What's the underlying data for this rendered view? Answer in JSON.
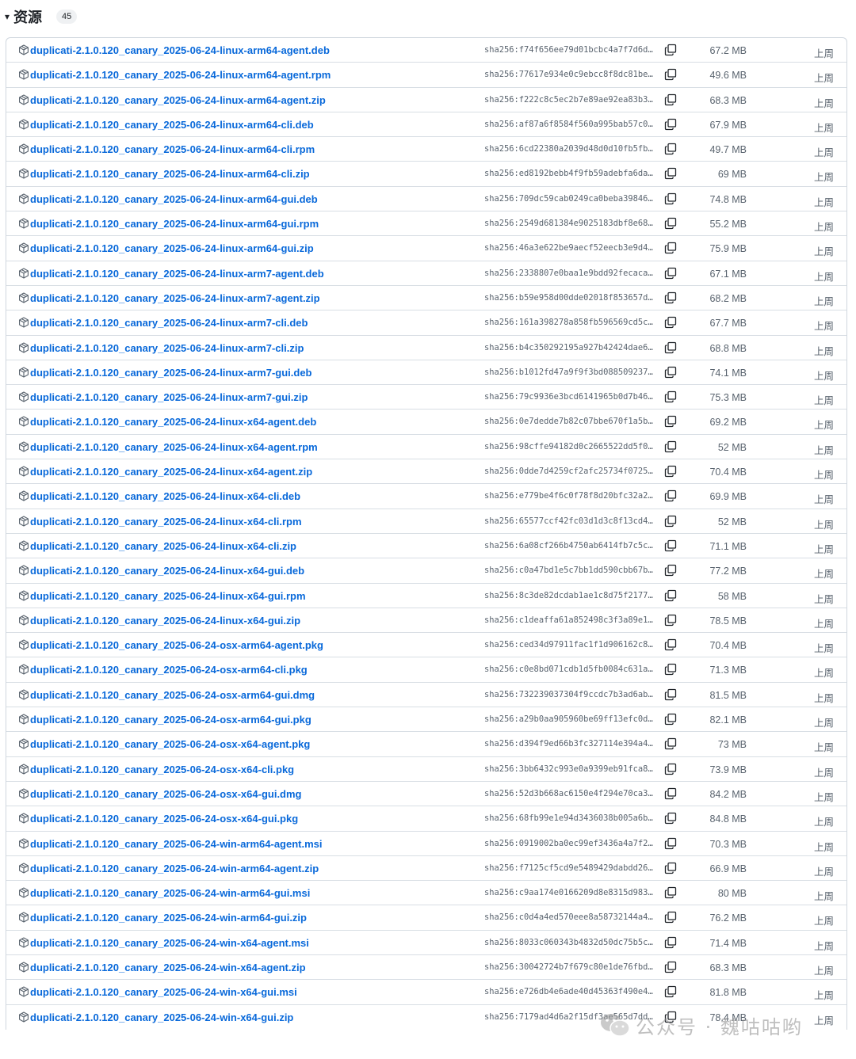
{
  "header": {
    "caret": "▾",
    "title": "资源",
    "count": "45"
  },
  "assets": [
    {
      "name": "duplicati-2.1.0.120_canary_2025-06-24-linux-arm64-agent.deb",
      "sha": "sha256:f74f656ee79d01bcbc4a7f7d6d…",
      "size": "67.2 MB",
      "time": "上周"
    },
    {
      "name": "duplicati-2.1.0.120_canary_2025-06-24-linux-arm64-agent.rpm",
      "sha": "sha256:77617e934e0c9ebcc8f8dc81be…",
      "size": "49.6 MB",
      "time": "上周"
    },
    {
      "name": "duplicati-2.1.0.120_canary_2025-06-24-linux-arm64-agent.zip",
      "sha": "sha256:f222c8c5ec2b7e89ae92ea83b3…",
      "size": "68.3 MB",
      "time": "上周"
    },
    {
      "name": "duplicati-2.1.0.120_canary_2025-06-24-linux-arm64-cli.deb",
      "sha": "sha256:af87a6f8584f560a995bab57c0…",
      "size": "67.9 MB",
      "time": "上周"
    },
    {
      "name": "duplicati-2.1.0.120_canary_2025-06-24-linux-arm64-cli.rpm",
      "sha": "sha256:6cd22380a2039d48d0d10fb5fb…",
      "size": "49.7 MB",
      "time": "上周"
    },
    {
      "name": "duplicati-2.1.0.120_canary_2025-06-24-linux-arm64-cli.zip",
      "sha": "sha256:ed8192bebb4f9fb59adebfa6da…",
      "size": "69 MB",
      "time": "上周"
    },
    {
      "name": "duplicati-2.1.0.120_canary_2025-06-24-linux-arm64-gui.deb",
      "sha": "sha256:709dc59cab0249ca0beba39846…",
      "size": "74.8 MB",
      "time": "上周"
    },
    {
      "name": "duplicati-2.1.0.120_canary_2025-06-24-linux-arm64-gui.rpm",
      "sha": "sha256:2549d681384e9025183dbf8e68…",
      "size": "55.2 MB",
      "time": "上周"
    },
    {
      "name": "duplicati-2.1.0.120_canary_2025-06-24-linux-arm64-gui.zip",
      "sha": "sha256:46a3e622be9aecf52eecb3e9d4…",
      "size": "75.9 MB",
      "time": "上周"
    },
    {
      "name": "duplicati-2.1.0.120_canary_2025-06-24-linux-arm7-agent.deb",
      "sha": "sha256:2338807e0baa1e9bdd92fecaca…",
      "size": "67.1 MB",
      "time": "上周"
    },
    {
      "name": "duplicati-2.1.0.120_canary_2025-06-24-linux-arm7-agent.zip",
      "sha": "sha256:b59e958d00dde02018f853657d…",
      "size": "68.2 MB",
      "time": "上周"
    },
    {
      "name": "duplicati-2.1.0.120_canary_2025-06-24-linux-arm7-cli.deb",
      "sha": "sha256:161a398278a858fb596569cd5c…",
      "size": "67.7 MB",
      "time": "上周"
    },
    {
      "name": "duplicati-2.1.0.120_canary_2025-06-24-linux-arm7-cli.zip",
      "sha": "sha256:b4c350292195a927b42424dae6…",
      "size": "68.8 MB",
      "time": "上周"
    },
    {
      "name": "duplicati-2.1.0.120_canary_2025-06-24-linux-arm7-gui.deb",
      "sha": "sha256:b1012fd47a9f9f3bd088509237…",
      "size": "74.1 MB",
      "time": "上周"
    },
    {
      "name": "duplicati-2.1.0.120_canary_2025-06-24-linux-arm7-gui.zip",
      "sha": "sha256:79c9936e3bcd6141965b0d7b46…",
      "size": "75.3 MB",
      "time": "上周"
    },
    {
      "name": "duplicati-2.1.0.120_canary_2025-06-24-linux-x64-agent.deb",
      "sha": "sha256:0e7dedde7b82c07bbe670f1a5b…",
      "size": "69.2 MB",
      "time": "上周"
    },
    {
      "name": "duplicati-2.1.0.120_canary_2025-06-24-linux-x64-agent.rpm",
      "sha": "sha256:98cffe94182d0c2665522dd5f0…",
      "size": "52 MB",
      "time": "上周"
    },
    {
      "name": "duplicati-2.1.0.120_canary_2025-06-24-linux-x64-agent.zip",
      "sha": "sha256:0dde7d4259cf2afc25734f0725…",
      "size": "70.4 MB",
      "time": "上周"
    },
    {
      "name": "duplicati-2.1.0.120_canary_2025-06-24-linux-x64-cli.deb",
      "sha": "sha256:e779be4f6c0f78f8d20bfc32a2…",
      "size": "69.9 MB",
      "time": "上周"
    },
    {
      "name": "duplicati-2.1.0.120_canary_2025-06-24-linux-x64-cli.rpm",
      "sha": "sha256:65577ccf42fc03d1d3c8f13cd4…",
      "size": "52 MB",
      "time": "上周"
    },
    {
      "name": "duplicati-2.1.0.120_canary_2025-06-24-linux-x64-cli.zip",
      "sha": "sha256:6a08cf266b4750ab6414fb7c5c…",
      "size": "71.1 MB",
      "time": "上周"
    },
    {
      "name": "duplicati-2.1.0.120_canary_2025-06-24-linux-x64-gui.deb",
      "sha": "sha256:c0a47bd1e5c7bb1dd590cbb67b…",
      "size": "77.2 MB",
      "time": "上周"
    },
    {
      "name": "duplicati-2.1.0.120_canary_2025-06-24-linux-x64-gui.rpm",
      "sha": "sha256:8c3de82dcdab1ae1c8d75f2177…",
      "size": "58 MB",
      "time": "上周"
    },
    {
      "name": "duplicati-2.1.0.120_canary_2025-06-24-linux-x64-gui.zip",
      "sha": "sha256:c1deaffa61a852498c3f3a89e1…",
      "size": "78.5 MB",
      "time": "上周"
    },
    {
      "name": "duplicati-2.1.0.120_canary_2025-06-24-osx-arm64-agent.pkg",
      "sha": "sha256:ced34d97911fac1f1d906162c8…",
      "size": "70.4 MB",
      "time": "上周"
    },
    {
      "name": "duplicati-2.1.0.120_canary_2025-06-24-osx-arm64-cli.pkg",
      "sha": "sha256:c0e8bd071cdb1d5fb0084c631a…",
      "size": "71.3 MB",
      "time": "上周"
    },
    {
      "name": "duplicati-2.1.0.120_canary_2025-06-24-osx-arm64-gui.dmg",
      "sha": "sha256:732239037304f9ccdc7b3ad6ab…",
      "size": "81.5 MB",
      "time": "上周"
    },
    {
      "name": "duplicati-2.1.0.120_canary_2025-06-24-osx-arm64-gui.pkg",
      "sha": "sha256:a29b0aa905960be69ff13efc0d…",
      "size": "82.1 MB",
      "time": "上周"
    },
    {
      "name": "duplicati-2.1.0.120_canary_2025-06-24-osx-x64-agent.pkg",
      "sha": "sha256:d394f9ed66b3fc327114e394a4…",
      "size": "73 MB",
      "time": "上周"
    },
    {
      "name": "duplicati-2.1.0.120_canary_2025-06-24-osx-x64-cli.pkg",
      "sha": "sha256:3bb6432c993e0a9399eb91fca8…",
      "size": "73.9 MB",
      "time": "上周"
    },
    {
      "name": "duplicati-2.1.0.120_canary_2025-06-24-osx-x64-gui.dmg",
      "sha": "sha256:52d3b668ac6150e4f294e70ca3…",
      "size": "84.2 MB",
      "time": "上周"
    },
    {
      "name": "duplicati-2.1.0.120_canary_2025-06-24-osx-x64-gui.pkg",
      "sha": "sha256:68fb99e1e94d3436038b005a6b…",
      "size": "84.8 MB",
      "time": "上周"
    },
    {
      "name": "duplicati-2.1.0.120_canary_2025-06-24-win-arm64-agent.msi",
      "sha": "sha256:0919002ba0ec99ef3436a4a7f2…",
      "size": "70.3 MB",
      "time": "上周"
    },
    {
      "name": "duplicati-2.1.0.120_canary_2025-06-24-win-arm64-agent.zip",
      "sha": "sha256:f7125cf5cd9e5489429dabdd26…",
      "size": "66.9 MB",
      "time": "上周"
    },
    {
      "name": "duplicati-2.1.0.120_canary_2025-06-24-win-arm64-gui.msi",
      "sha": "sha256:c9aa174e0166209d8e8315d983…",
      "size": "80 MB",
      "time": "上周"
    },
    {
      "name": "duplicati-2.1.0.120_canary_2025-06-24-win-arm64-gui.zip",
      "sha": "sha256:c0d4a4ed570eee8a58732144a4…",
      "size": "76.2 MB",
      "time": "上周"
    },
    {
      "name": "duplicati-2.1.0.120_canary_2025-06-24-win-x64-agent.msi",
      "sha": "sha256:8033c060343b4832d50dc75b5c…",
      "size": "71.4 MB",
      "time": "上周"
    },
    {
      "name": "duplicati-2.1.0.120_canary_2025-06-24-win-x64-agent.zip",
      "sha": "sha256:30042724b7f679c80e1de76fbd…",
      "size": "68.3 MB",
      "time": "上周"
    },
    {
      "name": "duplicati-2.1.0.120_canary_2025-06-24-win-x64-gui.msi",
      "sha": "sha256:e726db4e6ade40d45363f490e4…",
      "size": "81.8 MB",
      "time": "上周"
    },
    {
      "name": "duplicati-2.1.0.120_canary_2025-06-24-win-x64-gui.zip",
      "sha": "sha256:7179ad4d6a2f15df3ae565d7dd…",
      "size": "78.4 MB",
      "time": "上周"
    }
  ],
  "watermark": {
    "text": "公众号 · 魏咕咕哟",
    "icon": "wechat-logo-icon"
  },
  "colors": {
    "link": "#0969da",
    "muted": "#59636e",
    "border": "#d0d7de"
  }
}
